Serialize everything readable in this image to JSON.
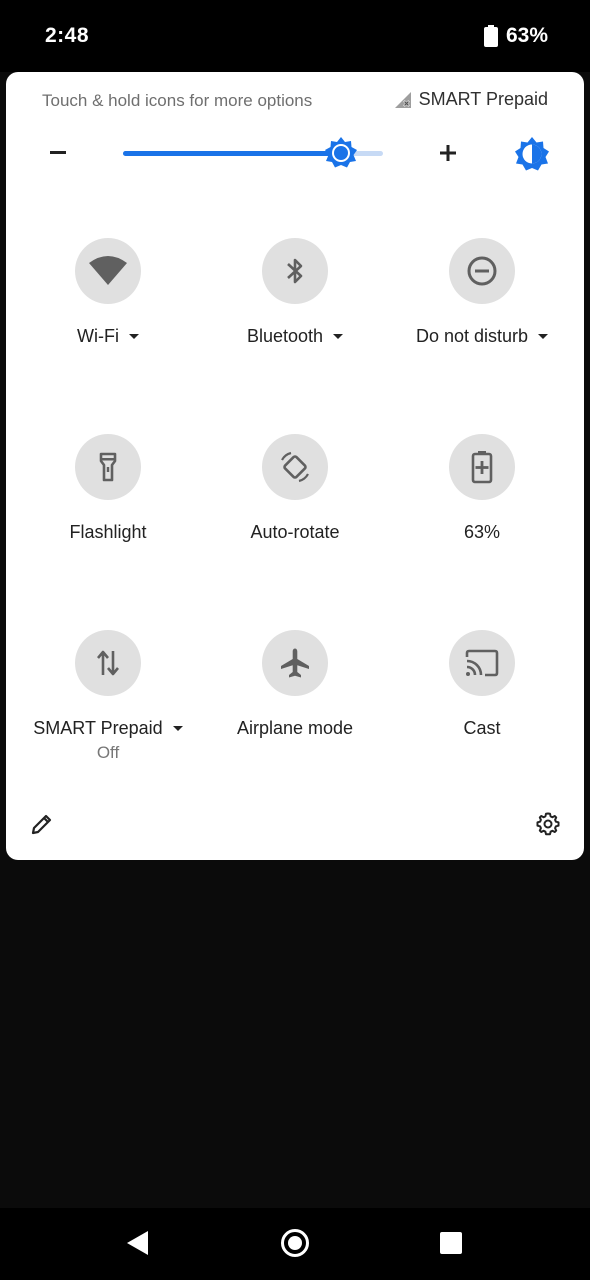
{
  "status_bar": {
    "time": "2:48",
    "battery": "63%"
  },
  "panel": {
    "hint": "Touch & hold icons for more options",
    "carrier": "SMART Prepaid",
    "brightness": {
      "level": 0.84,
      "minus": "−",
      "plus": "+"
    }
  },
  "tiles": [
    {
      "label": "Wi-Fi",
      "icon": "wifi-icon",
      "dropdown": true
    },
    {
      "label": "Bluetooth",
      "icon": "bluetooth-icon",
      "dropdown": true
    },
    {
      "label": "Do not disturb",
      "icon": "do-not-disturb-icon",
      "dropdown": true
    },
    {
      "label": "Flashlight",
      "icon": "flashlight-icon",
      "dropdown": false
    },
    {
      "label": "Auto-rotate",
      "icon": "auto-rotate-icon",
      "dropdown": false
    },
    {
      "label": "63%",
      "icon": "battery-saver-icon",
      "dropdown": false
    },
    {
      "label": "SMART Prepaid",
      "sublabel": "Off",
      "icon": "mobile-data-icon",
      "dropdown": true
    },
    {
      "label": "Airplane mode",
      "icon": "airplane-icon",
      "dropdown": false
    },
    {
      "label": "Cast",
      "icon": "cast-icon",
      "dropdown": false
    }
  ],
  "colors": {
    "accent": "#1a73e8",
    "tile_bg": "#e0e0e0",
    "icon": "#606060"
  }
}
